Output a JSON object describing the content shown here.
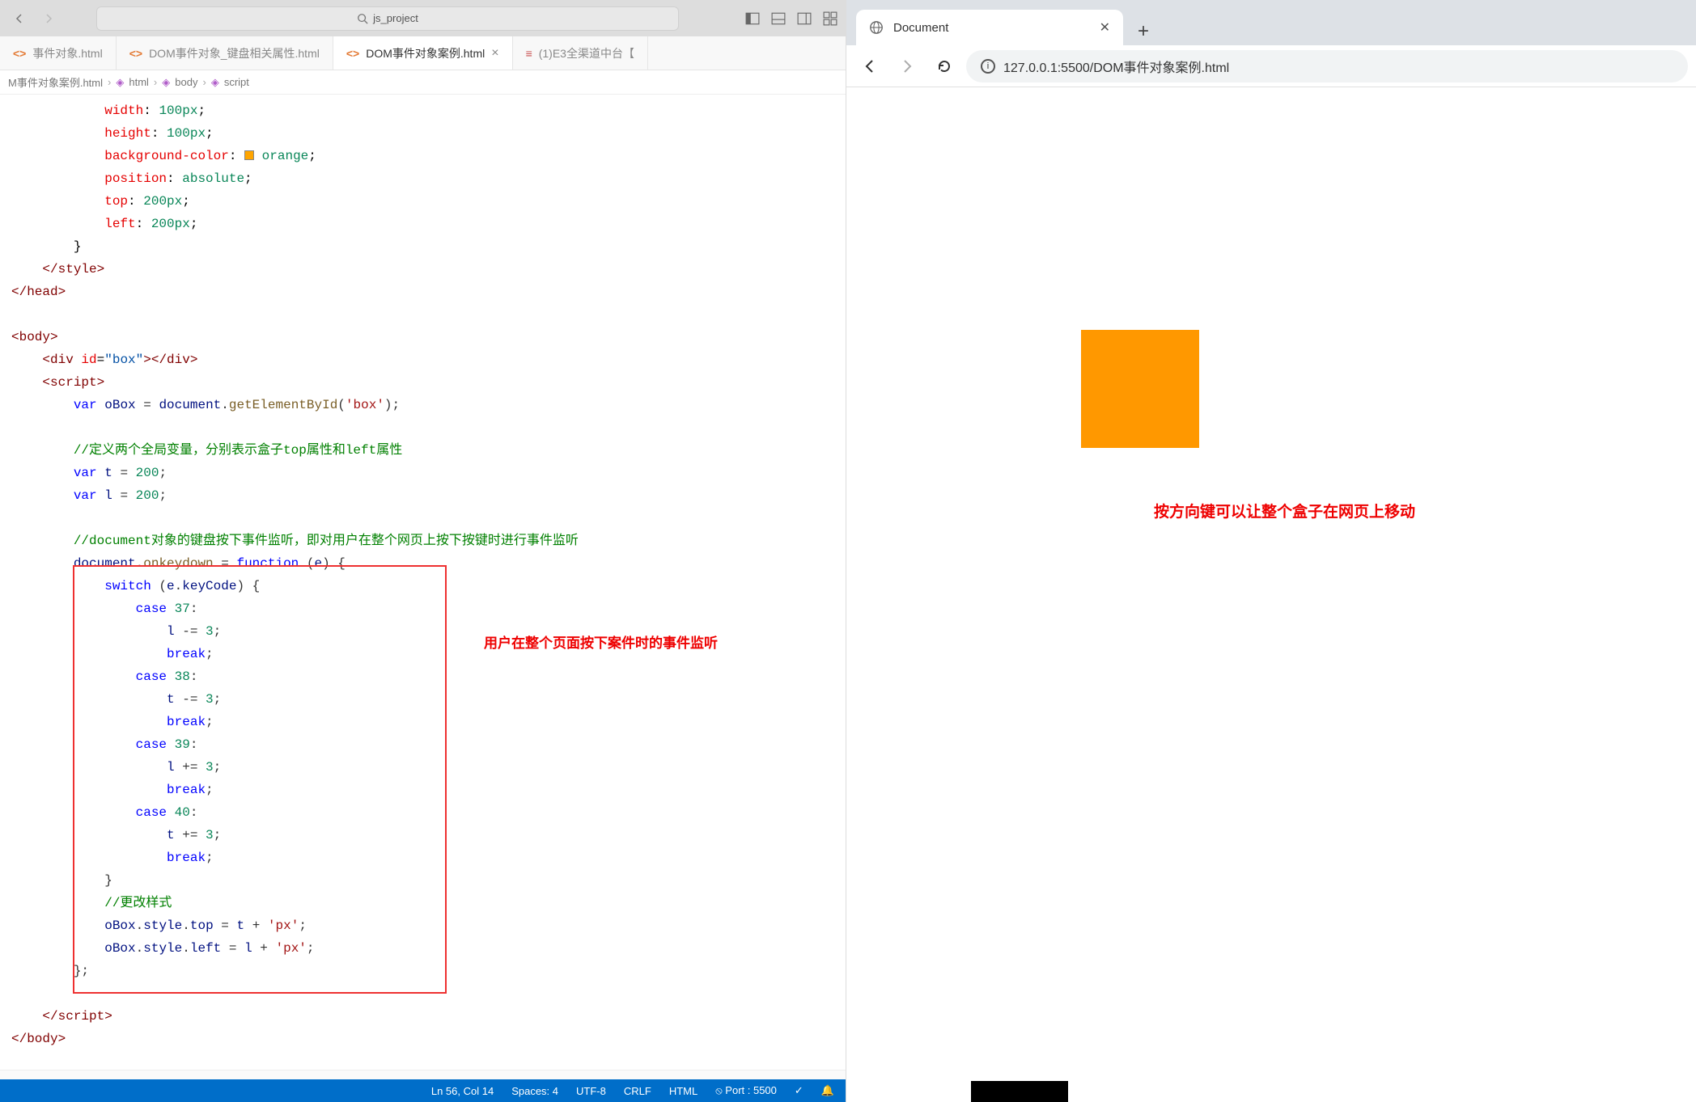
{
  "titlebar": {
    "search": "js_project"
  },
  "tabs": [
    {
      "label": "事件对象.html"
    },
    {
      "label": "DOM事件对象_键盘相关属性.html"
    },
    {
      "label": "DOM事件对象案例.html",
      "active": true
    },
    {
      "label": "(1)E3全渠道中台【"
    }
  ],
  "breadcrumbs": [
    "M事件对象案例.html",
    "html",
    "body",
    "script"
  ],
  "annotation": "用户在整个页面按下案件时的事件监听",
  "statusbar": {
    "lncol": "Ln 56, Col 14",
    "spaces": "Spaces: 4",
    "enc": "UTF-8",
    "eol": "CRLF",
    "lang": "HTML",
    "port": "Port : 5500"
  },
  "browser": {
    "tabTitle": "Document",
    "url": "127.0.0.1:5500/DOM事件对象案例.html",
    "text": "按方向键可以让整个盒子在网页上移动"
  },
  "code": {
    "c_width": "width",
    "c_height": "height",
    "c_bg": "background-color",
    "c_pos": "position",
    "c_top": "top",
    "c_left": "left",
    "v_100": "100px",
    "v_200": "200px",
    "v_orange": "orange",
    "v_abs": "absolute",
    "style_c": "</style>",
    "head_c": "</head>",
    "body_o": "<body>",
    "body_c": "</body>",
    "script_o": "<script>",
    "script_c": "</script>",
    "div1": "<div ",
    "div2": "id",
    "div3": "=",
    "div4": "\"box\"",
    "div5": "></div>",
    "var": "var",
    "oBox": "oBox",
    "eq": " = ",
    "doc": "document",
    "dot": ".",
    "gebi": "getElementById",
    "p1": "(",
    "p2": ")",
    "box": "'box'",
    "semi": ";",
    "cmt1": "//定义两个全局变量，分别表示盒子top属性和left属性",
    "t": "t",
    "l": "l",
    "n200": "200",
    "cmt2": "//document对象的键盘按下事件监听，即对用户在整个网页上按下按键时进行事件监听",
    "onkey": "onkeydown",
    "func": "function",
    "e": "e",
    "brace_o": "{",
    "brace_c": "}",
    "switch": "switch",
    "keycode": "keyCode",
    "case": "case",
    "c37": "37",
    "c38": "38",
    "c39": "39",
    "c40": "40",
    "colon": ":",
    "minus": " -= ",
    "plus": " += ",
    "n3": "3",
    "break": "break",
    "cmt3": "//更改样式",
    "style": "style",
    "stop": "top",
    "sleft": "left",
    "pxq": "'px'",
    "pl": " + "
  }
}
